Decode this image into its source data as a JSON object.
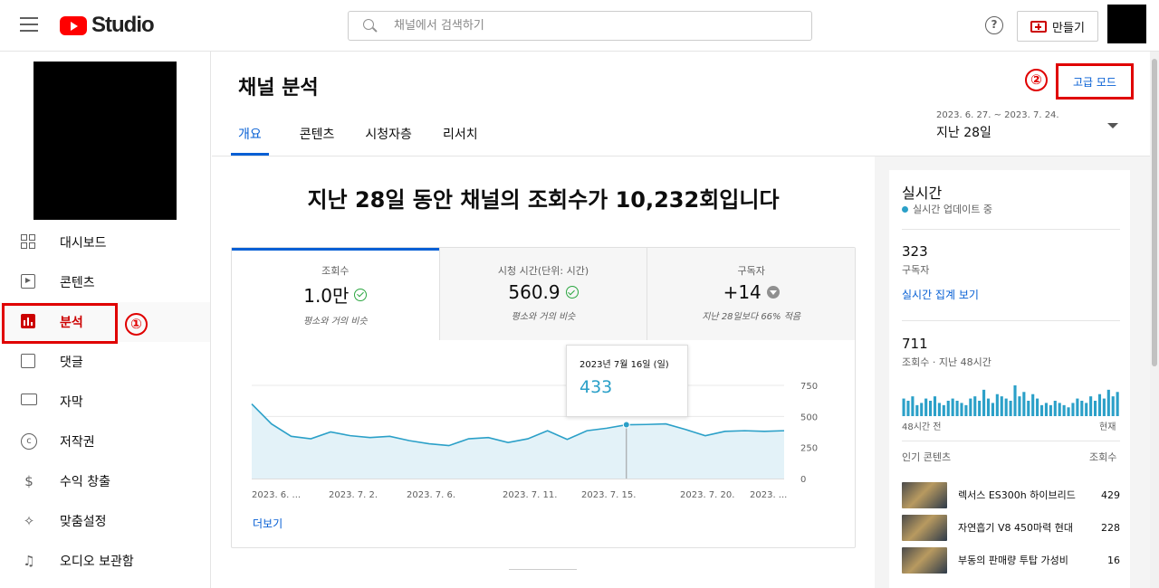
{
  "app": {
    "logo_text": "Studio"
  },
  "search": {
    "placeholder": "채널에서 검색하기"
  },
  "header": {
    "create_label": "만들기"
  },
  "sidebar": {
    "items": [
      {
        "label": "대시보드",
        "icon": "dashboard-icon"
      },
      {
        "label": "콘텐츠",
        "icon": "content-icon"
      },
      {
        "label": "분석",
        "icon": "analytics-icon",
        "active": true
      },
      {
        "label": "댓글",
        "icon": "comments-icon"
      },
      {
        "label": "자막",
        "icon": "subtitles-icon"
      },
      {
        "label": "저작권",
        "icon": "copyright-icon"
      },
      {
        "label": "수익 창출",
        "icon": "monetization-icon"
      },
      {
        "label": "맞춤설정",
        "icon": "customization-icon"
      },
      {
        "label": "오디오 보관함",
        "icon": "audio-library-icon"
      }
    ],
    "annotation": "①"
  },
  "main": {
    "title": "채널 분석",
    "advanced_mode": "고급 모드",
    "annotation": "②",
    "tabs": [
      {
        "label": "개요",
        "active": true
      },
      {
        "label": "콘텐츠"
      },
      {
        "label": "시청자층"
      },
      {
        "label": "리서치"
      }
    ],
    "date_range": "2023. 6. 27. ~ 2023. 7. 24.",
    "date_label": "지난 28일",
    "headline": "지난 28일 동안 채널의 조회수가 10,232회입니다",
    "metrics": [
      {
        "label": "조회수",
        "value": "1.0만",
        "sub": "평소와 거의 비슷",
        "status": "check"
      },
      {
        "label": "시청 시간(단위: 시간)",
        "value": "560.9",
        "sub": "평소와 거의 비슷",
        "status": "check"
      },
      {
        "label": "구독자",
        "value": "+14",
        "sub": "지난 28일보다 66% 적음",
        "status": "down"
      }
    ],
    "tooltip": {
      "date": "2023년 7월 16일 (일)",
      "value": "433"
    },
    "more_link": "더보기"
  },
  "chart_data": {
    "type": "area",
    "x_tick_labels": [
      "2023. 6. ...",
      "2023. 7. 2.",
      "2023. 7. 6.",
      "2023. 7. 11.",
      "2023. 7. 15.",
      "2023. 7. 20.",
      "2023. ..."
    ],
    "y_tick_labels": [
      "750",
      "500",
      "250",
      "0"
    ],
    "ylim": [
      0,
      750
    ],
    "values": [
      600,
      440,
      340,
      320,
      375,
      345,
      330,
      340,
      305,
      280,
      265,
      320,
      330,
      290,
      320,
      385,
      315,
      385,
      405,
      433,
      435,
      440,
      395,
      345,
      380,
      385,
      380,
      385
    ],
    "highlight_index": 19,
    "color": "#2ba0c8"
  },
  "realtime": {
    "title": "실시간",
    "live_label": "실시간 업데이트 중",
    "subscribers": "323",
    "subscribers_label": "구독자",
    "link": "실시간 집계 보기",
    "views": "711",
    "views_label": "조회수 · 지난 48시간",
    "axis_left": "48시간 전",
    "axis_right": "현재",
    "top_header": "인기 콘텐츠",
    "top_header_right": "조회수",
    "bars": [
      8,
      7,
      9,
      5,
      6,
      8,
      7,
      9,
      6,
      5,
      7,
      8,
      7,
      6,
      5,
      8,
      9,
      7,
      12,
      8,
      6,
      10,
      9,
      8,
      7,
      14,
      9,
      11,
      7,
      10,
      8,
      5,
      6,
      5,
      7,
      6,
      5,
      4,
      6,
      8,
      7,
      6,
      9,
      7,
      10,
      8,
      12,
      9,
      11
    ],
    "top_content": [
      {
        "title": "렉서스 ES300h 하이브리드",
        "views": "429"
      },
      {
        "title": "자연흡기 V8 450마력 현대",
        "views": "228"
      },
      {
        "title": "부동의 판매량 투탑 가성비",
        "views": "16"
      }
    ]
  }
}
